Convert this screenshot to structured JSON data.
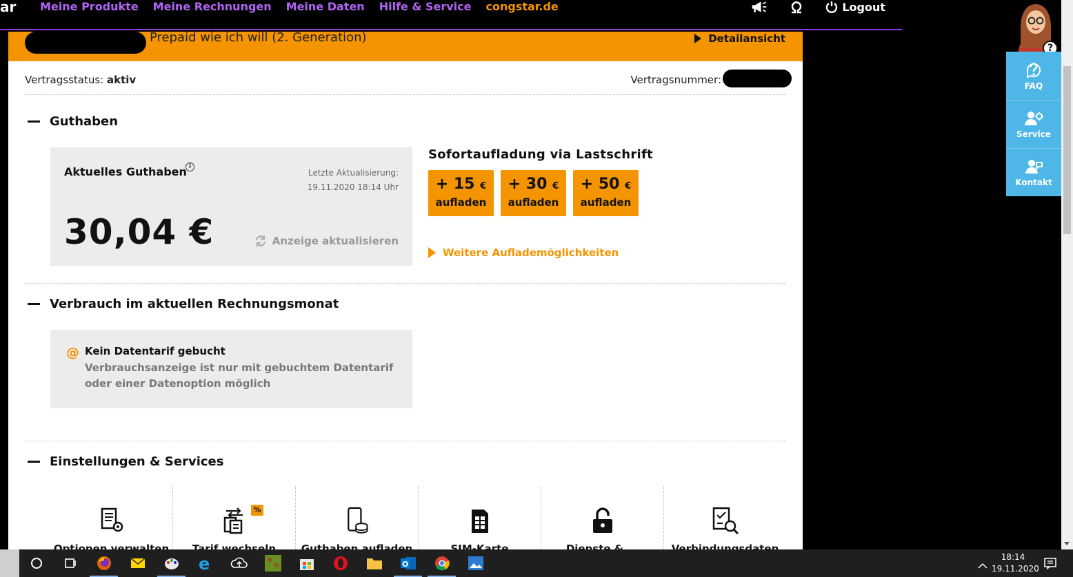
{
  "nav": {
    "logo_fragment": "ar",
    "links": [
      "Meine Produkte",
      "Meine Rechnungen",
      "Meine Daten",
      "Hilfe & Service"
    ],
    "brand_link": "congstar.de",
    "logout": "Logout",
    "icons": [
      "megaphone-icon",
      "omega-icon",
      "power-icon"
    ]
  },
  "header": {
    "tariff_name": "Prepaid wie ich will (2. Generation)",
    "detail_link": "Detailansicht"
  },
  "status": {
    "label": "Vertragsstatus:",
    "value": "aktiv",
    "contract_label": "Vertragsnummer:"
  },
  "guthaben": {
    "section_title": "Guthaben",
    "box_title": "Aktuelles Guthaben",
    "info_glyph": "i",
    "update_label": "Letzte Aktualisierung:",
    "update_time": "19.11.2020 18:14 Uhr",
    "amount": "30,04 €",
    "refresh_label": "Anzeige aktualisieren",
    "topup_title": "Sofortaufladung via Lastschrift",
    "topup_buttons": [
      {
        "amount": "+ 15",
        "currency": "€",
        "label": "aufladen"
      },
      {
        "amount": "+ 30",
        "currency": "€",
        "label": "aufladen"
      },
      {
        "amount": "+ 50",
        "currency": "€",
        "label": "aufladen"
      }
    ],
    "more_link": "Weitere Auflademöglichkeiten"
  },
  "verbrauch": {
    "section_title": "Verbrauch im aktuellen Rechnungsmonat",
    "at_glyph": "@",
    "title": "Kein Datentarif gebucht",
    "text": "Verbrauchsanzeige ist nur mit gebuchtem Datentarif oder einer Datenoption möglich"
  },
  "einstellungen": {
    "section_title": "Einstellungen & Services",
    "items": [
      {
        "label": "Optionen verwalten",
        "icon": "options-settings-icon"
      },
      {
        "label": "Tarif wechseln",
        "icon": "tariff-switch-icon",
        "badge": "%"
      },
      {
        "label": "Guthaben aufladen",
        "icon": "phone-coins-icon"
      },
      {
        "label": "SIM-Karte",
        "icon": "sim-card-icon"
      },
      {
        "label": "Dienste & ...",
        "icon": "lock-icon"
      },
      {
        "label": "Verbindungsdaten",
        "icon": "document-search-icon"
      }
    ]
  },
  "side_panel": {
    "help_glyph": "?",
    "items": [
      {
        "label": "FAQ",
        "icon": "faq-icon"
      },
      {
        "label": "Service",
        "icon": "service-icon"
      },
      {
        "label": "Kontakt",
        "icon": "contact-icon"
      }
    ]
  },
  "taskbar": {
    "time": "18:14",
    "date": "19.11.2020",
    "apps": [
      "cortana",
      "task-view",
      "firefox",
      "mail",
      "paint",
      "internet-explorer",
      "cloud-upload",
      "minecraft",
      "store",
      "opera",
      "file-explorer",
      "outlook",
      "chrome",
      "photos"
    ]
  }
}
